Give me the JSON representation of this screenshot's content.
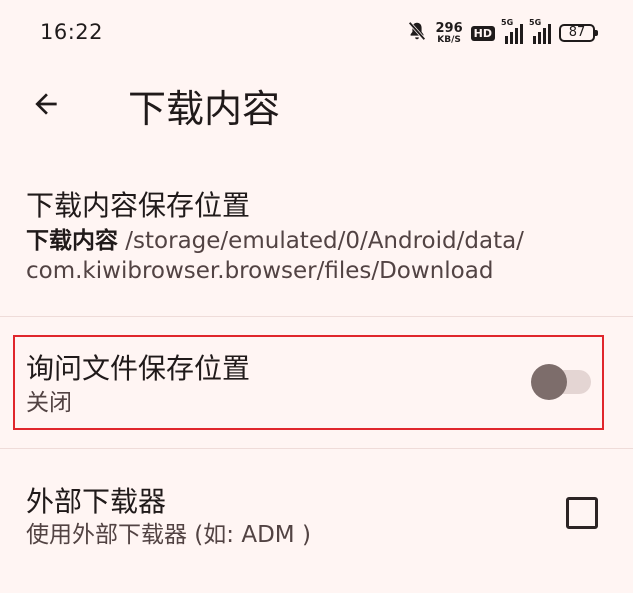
{
  "status_bar": {
    "time": "16:22",
    "net_speed_value": "296",
    "net_speed_unit": "KB/S",
    "hd_label": "HD",
    "signal1_label": "5G",
    "signal2_label": "5G",
    "battery": "87",
    "icons": [
      "mute-bell-icon",
      "hd-icon",
      "signal-5g-icon",
      "signal-5g-icon",
      "battery-icon"
    ]
  },
  "app_bar": {
    "title": "下载内容",
    "back_icon": "arrow-left-icon"
  },
  "settings": {
    "download_location": {
      "title": "下载内容保存位置",
      "summary_bold": "下载内容",
      "summary_path_line1": " /storage/emulated/0/Android/data/",
      "summary_path_line2": "com.kiwibrowser.browser/files/Download"
    },
    "ask_location": {
      "title": "询问文件保存位置",
      "summary": "关闭",
      "enabled": false
    },
    "external_downloader": {
      "title": "外部下载器",
      "summary": "使用外部下载器 (如: ADM )",
      "checked": false
    }
  },
  "colors": {
    "background": "#fff5f3",
    "highlight_border": "#e0262c",
    "switch_thumb": "#7d6d6b",
    "switch_track": "#e4d5d3"
  }
}
